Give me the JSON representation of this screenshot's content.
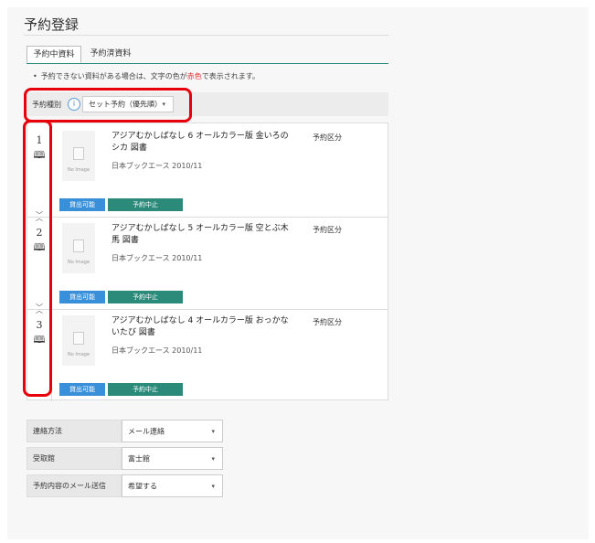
{
  "page": {
    "title": "予約登録"
  },
  "tabs": [
    {
      "label": "予約中資料",
      "active": true
    },
    {
      "label": "予約済資料",
      "active": false
    }
  ],
  "notice": {
    "bullet": "•",
    "before": "予約できない資料がある場合は、文字の色が",
    "red_word": "赤色",
    "after": "で表示されます。"
  },
  "filter": {
    "label": "予約種別",
    "info_icon": "i",
    "selected": "セット予約（優先順）",
    "caret": "▾"
  },
  "items": [
    {
      "num": "1",
      "title": "アジアむかしばなし 6 オールカラー版 金いろのシカ 図書",
      "publisher": "日本ブックエース 2010/11",
      "category": "予約区分",
      "no_image": "No Image",
      "avail_label": "貸出可能",
      "stop_label": "予約中止"
    },
    {
      "num": "2",
      "title": "アジアむかしばなし 5 オールカラー版 空とぶ木馬 図書",
      "publisher": "日本ブックエース 2010/11",
      "category": "予約区分",
      "no_image": "No Image",
      "avail_label": "貸出可能",
      "stop_label": "予約中止"
    },
    {
      "num": "3",
      "title": "アジアむかしばなし 4 オールカラー版 おっかないたび 図書",
      "publisher": "日本ブックエース 2010/11",
      "category": "予約区分",
      "no_image": "No Image",
      "avail_label": "貸出可能",
      "stop_label": "予約中止"
    }
  ],
  "handle_icons": {
    "up": "︿",
    "down": "﹀",
    "book": "🕮"
  },
  "form": [
    {
      "label": "連絡方法",
      "value": "メール連絡"
    },
    {
      "label": "受取館",
      "value": "富士館"
    },
    {
      "label": "予約内容のメール送信",
      "value": "希望する"
    }
  ],
  "colors": {
    "accent": "#2b8a7a",
    "available": "#3a8fd9",
    "highlight": "#e8000b",
    "notice_red": "#e03030"
  }
}
